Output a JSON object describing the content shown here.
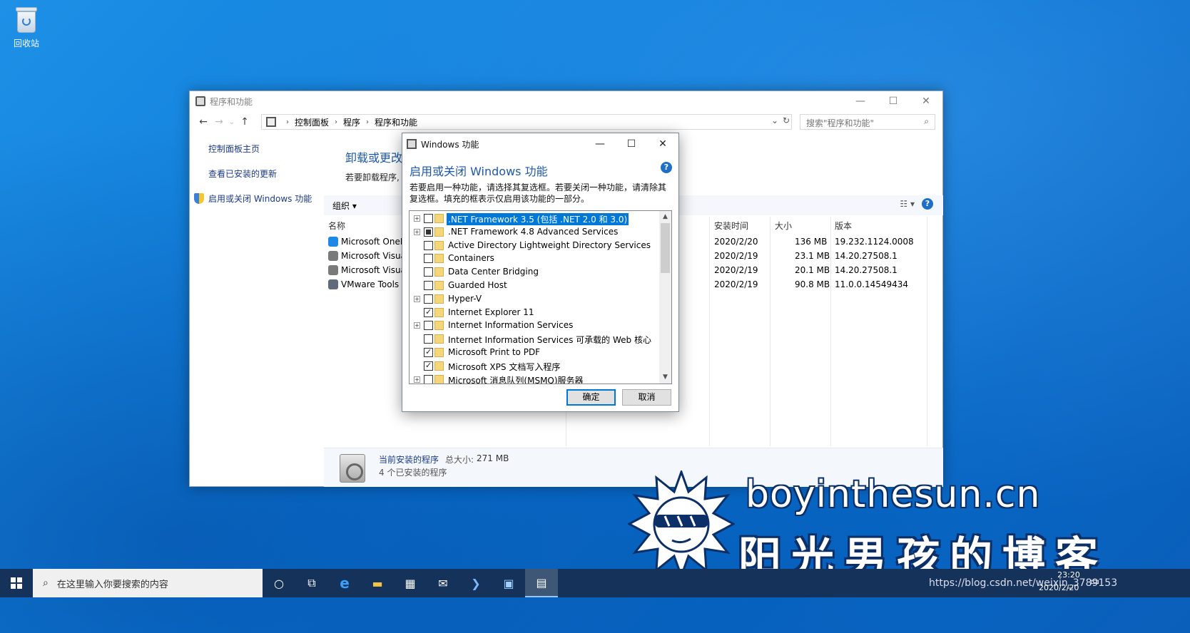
{
  "desktop": {
    "recycle_bin_label": "回收站"
  },
  "main_window": {
    "title": "程序和功能",
    "breadcrumb": [
      "控制面板",
      "程序",
      "程序和功能"
    ],
    "search_placeholder": "搜索\"程序和功能\"",
    "left_nav": {
      "home": "控制面板主页",
      "view_updates": "查看已安装的更新",
      "windows_features": "启用或关闭 Windows 功能"
    },
    "content_title": "卸载或更改程",
    "content_desc": "若要卸载程序,",
    "toolbar": {
      "organize": "组织 ▾"
    },
    "columns": {
      "name": "名称",
      "installed_on": "安装时间",
      "size": "大小",
      "version": "版本"
    },
    "programs": [
      {
        "name": "Microsoft OneD",
        "installed_on": "2020/2/20",
        "size": "136 MB",
        "version": "19.232.1124.0008",
        "icon_color": "#1e88e5"
      },
      {
        "name": "Microsoft Visua",
        "installed_on": "2020/2/19",
        "size": "23.1 MB",
        "version": "14.20.27508.1",
        "icon_color": "#7a7a7a"
      },
      {
        "name": "Microsoft Visua",
        "installed_on": "2020/2/19",
        "size": "20.1 MB",
        "version": "14.20.27508.1",
        "icon_color": "#7a7a7a"
      },
      {
        "name": "VMware Tools",
        "installed_on": "2020/2/19",
        "size": "90.8 MB",
        "version": "11.0.0.14549434",
        "icon_color": "#5f6b7a"
      }
    ],
    "status": {
      "title": "当前安装的程序",
      "total_label": "总大小:",
      "total_value": "271 MB",
      "count": "4 个已安装的程序"
    }
  },
  "features_dialog": {
    "title": "Windows 功能",
    "heading": "启用或关闭 Windows 功能",
    "description": "若要启用一种功能，请选择其复选框。若要关闭一种功能，请清除其复选框。填充的框表示仅启用该功能的一部分。",
    "features": [
      {
        "label": ".NET Framework 3.5 (包括 .NET 2.0 和 3.0)",
        "expandable": true,
        "state": "unchecked",
        "selected": true
      },
      {
        "label": ".NET Framework 4.8 Advanced Services",
        "expandable": true,
        "state": "partial",
        "selected": false
      },
      {
        "label": "Active Directory Lightweight Directory Services",
        "expandable": false,
        "state": "unchecked",
        "selected": false
      },
      {
        "label": "Containers",
        "expandable": false,
        "state": "unchecked",
        "selected": false
      },
      {
        "label": "Data Center Bridging",
        "expandable": false,
        "state": "unchecked",
        "selected": false
      },
      {
        "label": "Guarded Host",
        "expandable": false,
        "state": "unchecked",
        "selected": false
      },
      {
        "label": "Hyper-V",
        "expandable": true,
        "state": "unchecked",
        "selected": false
      },
      {
        "label": "Internet Explorer 11",
        "expandable": false,
        "state": "checked",
        "selected": false
      },
      {
        "label": "Internet Information Services",
        "expandable": true,
        "state": "unchecked",
        "selected": false
      },
      {
        "label": "Internet Information Services 可承载的 Web 核心",
        "expandable": false,
        "state": "unchecked",
        "selected": false
      },
      {
        "label": "Microsoft Print to PDF",
        "expandable": false,
        "state": "checked",
        "selected": false
      },
      {
        "label": "Microsoft XPS 文档写入程序",
        "expandable": false,
        "state": "checked",
        "selected": false
      },
      {
        "label": "Microsoft 消息队列(MSMQ)服务器",
        "expandable": true,
        "state": "unchecked",
        "selected": false
      }
    ],
    "ok_label": "确定",
    "cancel_label": "取消"
  },
  "watermark": {
    "domain": "boyinthesun.cn",
    "tagline": "阳光男孩的博客"
  },
  "taskbar": {
    "search_placeholder": "在这里输入你要搜索的内容",
    "tray_url": "https://blog.csdn.net/weixin_3789153",
    "time": "23:20",
    "date": "2020/2/20"
  }
}
